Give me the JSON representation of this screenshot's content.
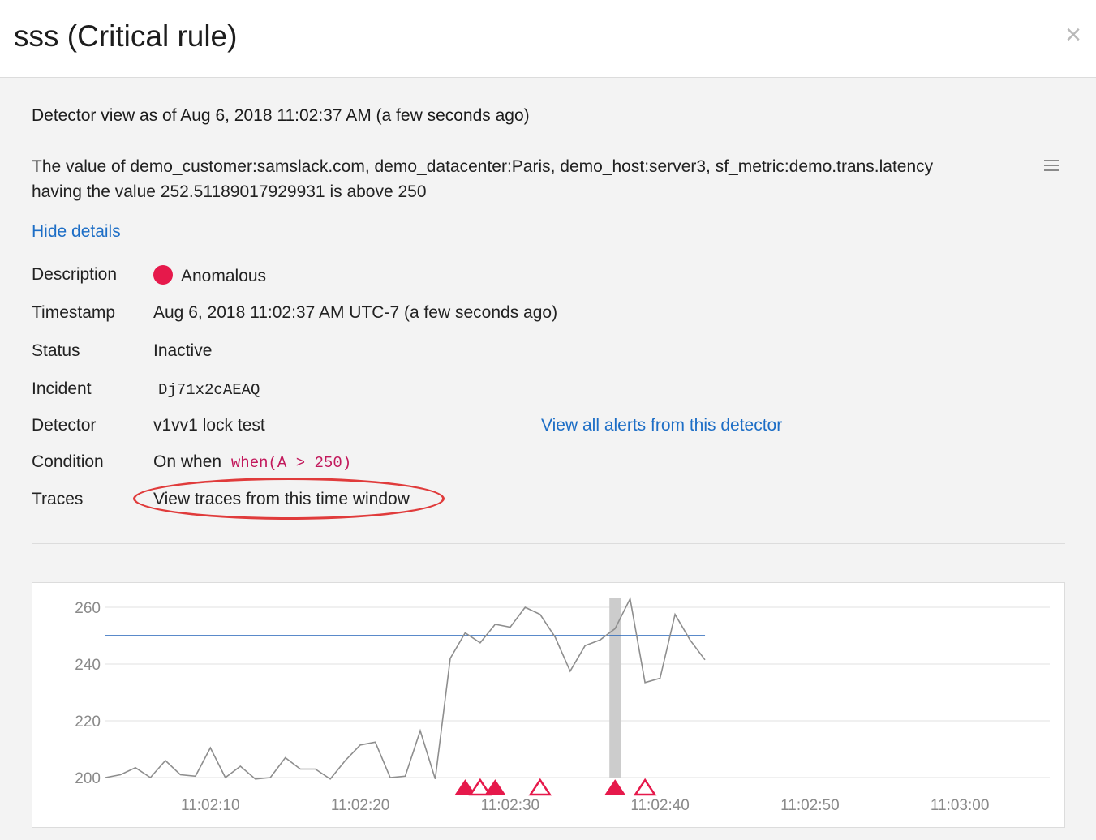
{
  "header": {
    "title": "sss (Critical rule)",
    "close_glyph": "×"
  },
  "view_as": "Detector view as of Aug 6, 2018 11:02:37 AM (a few seconds ago)",
  "summary": {
    "line1": "The value of demo_customer:samslack.com, demo_datacenter:Paris, demo_host:server3, sf_metric:demo.trans.latency",
    "line2": "having the value 252.51189017929931 is  above 250"
  },
  "hide_details": "Hide details",
  "details": {
    "description": {
      "label": "Description",
      "value": "Anomalous",
      "dot_color": "#e6194b"
    },
    "timestamp": {
      "label": "Timestamp",
      "value": "Aug 6, 2018 11:02:37 AM UTC-7 (a few seconds ago)"
    },
    "status": {
      "label": "Status",
      "value": "Inactive"
    },
    "incident": {
      "label": "Incident",
      "value": "Dj71x2cAEAQ"
    },
    "detector": {
      "label": "Detector",
      "value": "v1vv1 lock test",
      "alerts_link": "View all alerts from this detector"
    },
    "condition": {
      "label": "Condition",
      "prefix": "On when",
      "code": "when(A > 250)"
    },
    "traces": {
      "label": "Traces",
      "link": "View traces from this time window"
    }
  },
  "chart_data": {
    "type": "line",
    "title": "",
    "xlabel": "",
    "ylabel": "",
    "ylim": [
      200,
      260
    ],
    "yticks": [
      200,
      220,
      240,
      260
    ],
    "xtick_labels": [
      "11:02:10",
      "11:02:20",
      "11:02:30",
      "11:02:40",
      "11:02:50",
      "11:03:00"
    ],
    "xtick_seconds": [
      10,
      20,
      30,
      40,
      50,
      60
    ],
    "xlim_seconds": [
      3,
      66
    ],
    "grid": true,
    "threshold": 250,
    "threshold_color": "#2363b8",
    "line_color": "#8e8e8e",
    "highlight_second": 37,
    "series": [
      {
        "x": [
          3,
          4,
          5,
          6,
          7,
          8,
          9,
          10,
          11,
          12,
          13,
          14,
          15,
          16,
          17,
          18,
          19,
          20,
          21,
          22,
          23,
          24,
          25,
          26,
          27,
          28,
          29,
          30,
          31,
          32,
          33,
          34,
          35,
          36,
          37,
          38,
          39,
          40,
          41,
          42,
          43
        ],
        "values": [
          200,
          201,
          203.5,
          200,
          206,
          201,
          200.5,
          210.5,
          200,
          204,
          199.5,
          200,
          207,
          203,
          203,
          199.5,
          206,
          211.5,
          212.5,
          200,
          200.5,
          216.5,
          199.5,
          242,
          251,
          247.5,
          254,
          253,
          260,
          257.5,
          249.5,
          237.5,
          246.5,
          248.5,
          252.5,
          263,
          233.5,
          235,
          257.5,
          248.5,
          241.5
        ]
      }
    ],
    "markers": [
      {
        "x": 27,
        "type": "filled",
        "color": "#e6194b"
      },
      {
        "x": 28,
        "type": "open",
        "color": "#e6194b"
      },
      {
        "x": 29,
        "type": "filled",
        "color": "#e6194b"
      },
      {
        "x": 32,
        "type": "open",
        "color": "#e6194b"
      },
      {
        "x": 37,
        "type": "filled",
        "color": "#e6194b"
      },
      {
        "x": 39,
        "type": "open",
        "color": "#e6194b"
      }
    ]
  }
}
